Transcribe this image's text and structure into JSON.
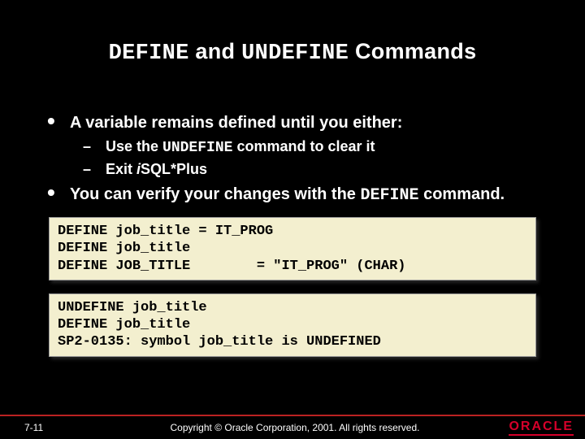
{
  "title": {
    "part1": "DEFINE",
    "part2": " and ",
    "part3": "UNDEFINE",
    "part4": " Commands"
  },
  "bullets": {
    "b1": "A variable remains defined until you either:",
    "s1a_pre": "Use the ",
    "s1a_mono": "UNDEFINE",
    "s1a_post": " command to clear it",
    "s1b_pre": "Exit ",
    "s1b_ital": "i",
    "s1b_post": "SQL*Plus",
    "b2_pre": "You can verify your changes with the ",
    "b2_mono": "DEFINE",
    "b2_post": " command."
  },
  "code1": "DEFINE job_title = IT_PROG\nDEFINE job_title\nDEFINE JOB_TITLE        = \"IT_PROG\" (CHAR)",
  "code2": "UNDEFINE job_title\nDEFINE job_title\nSP2-0135: symbol job_title is UNDEFINED",
  "footer": {
    "page": "7-11",
    "copyright": "Copyright © Oracle Corporation, 2001. All rights reserved.",
    "logo": "ORACLE"
  }
}
